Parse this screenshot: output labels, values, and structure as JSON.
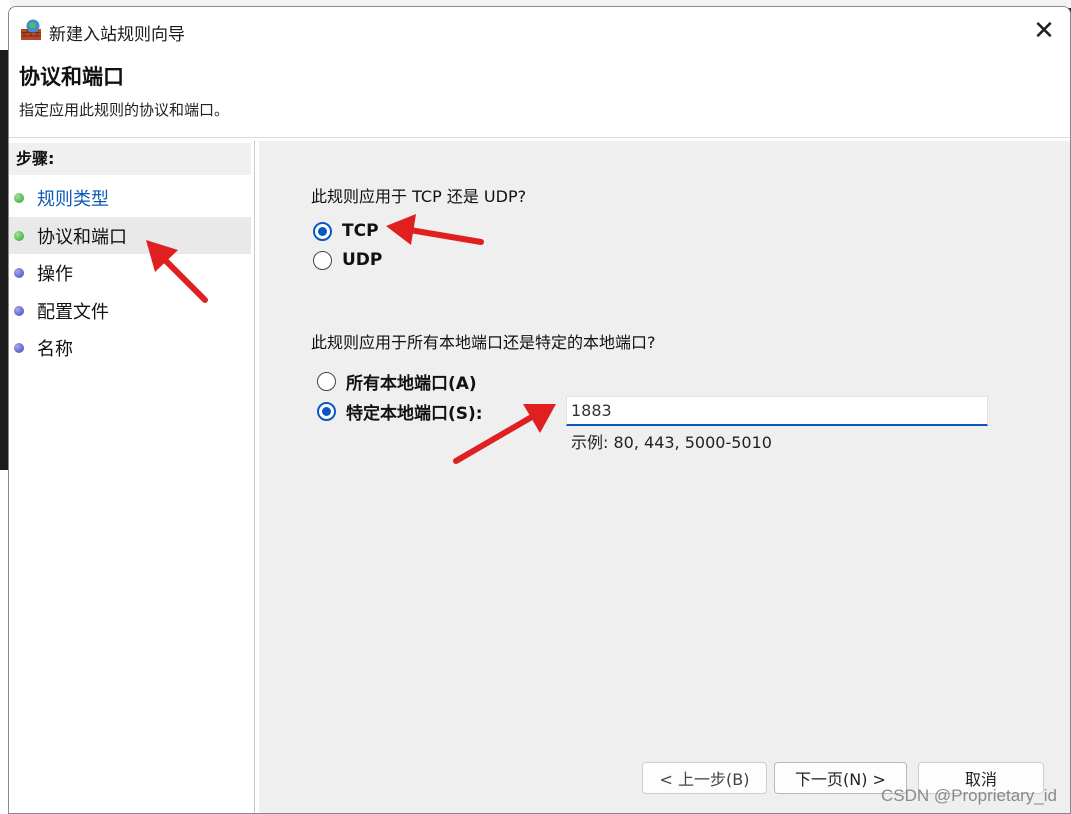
{
  "window": {
    "title": "新建入站规则向导",
    "close_glyph": "✕"
  },
  "header": {
    "title": "协议和端口",
    "subtitle": "指定应用此规则的协议和端口。"
  },
  "steps": {
    "heading": "步骤:",
    "items": [
      {
        "label": "规则类型",
        "status": "done",
        "link": true
      },
      {
        "label": "协议和端口",
        "status": "current",
        "link": false
      },
      {
        "label": "操作",
        "status": "pending",
        "link": false
      },
      {
        "label": "配置文件",
        "status": "pending",
        "link": false
      },
      {
        "label": "名称",
        "status": "pending",
        "link": false
      }
    ]
  },
  "protocol": {
    "question": "此规则应用于 TCP 还是 UDP?",
    "options": [
      {
        "label": "TCP",
        "checked": true
      },
      {
        "label": "UDP",
        "checked": false
      }
    ]
  },
  "ports": {
    "question": "此规则应用于所有本地端口还是特定的本地端口?",
    "options": [
      {
        "label": "所有本地端口(A)",
        "checked": false
      },
      {
        "label": "特定本地端口(S):",
        "checked": true
      }
    ],
    "value": "1883",
    "example": "示例: 80, 443, 5000-5010"
  },
  "buttons": {
    "back": "< 上一步(B)",
    "next": "下一页(N) >",
    "cancel": "取消"
  },
  "watermark": "CSDN @Proprietary_id",
  "colors": {
    "accent": "#0a57c2",
    "annotation_arrow": "#e02020",
    "step_done": "#2f9e2a",
    "step_pending": "#3b3fb7"
  }
}
